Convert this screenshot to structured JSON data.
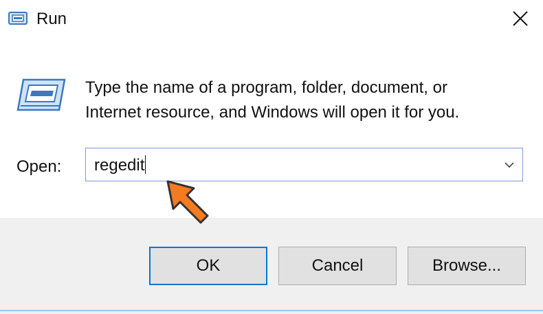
{
  "window": {
    "title": "Run"
  },
  "icons": {
    "app": "run-icon",
    "close": "close-icon",
    "dropdown": "chevron-down-icon",
    "pointer": "arrow-pointer-icon"
  },
  "description": {
    "line1": "Type the name of a program, folder, document, or",
    "line2": "Internet resource, and Windows will open it for you."
  },
  "open": {
    "label": "Open:",
    "value": "regedit"
  },
  "buttons": {
    "ok": "OK",
    "cancel": "Cancel",
    "browse": "Browse..."
  },
  "colors": {
    "accent": "#0078d7",
    "pointer": "#f47b20",
    "footer": "#f0f0f0"
  }
}
